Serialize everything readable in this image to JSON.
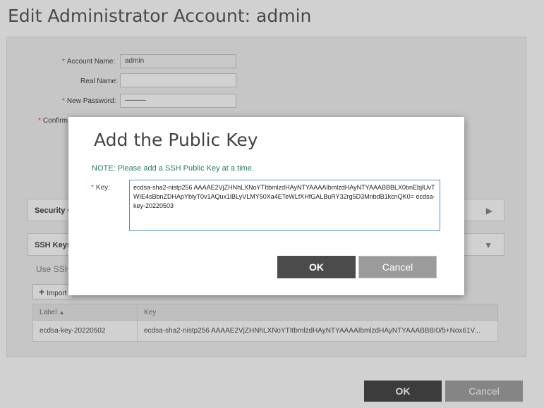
{
  "page": {
    "title": "Edit Administrator Account: admin"
  },
  "form": {
    "account_name_label": "Account Name:",
    "account_name_value": "admin",
    "real_name_label": "Real Name:",
    "real_name_value": "",
    "new_password_label": "New Password:",
    "new_password_value": "———",
    "confirm_label": "Confirm"
  },
  "sections": {
    "security_title": "Security C",
    "ssh_title": "SSH Keys"
  },
  "ssh": {
    "note": "Use SSH",
    "import_label": "Import",
    "table": {
      "col_label": "Label",
      "col_key": "Key",
      "rows": [
        {
          "label": "ecdsa-key-20220502",
          "key": "ecdsa-sha2-nistp256 AAAAE2VjZHNhLXNoYTItbmlzdHAyNTYAAAAIbmlzdHAyNTYAAABBBI0/5+Nox61V..."
        }
      ]
    }
  },
  "buttons": {
    "ok": "OK",
    "cancel": "Cancel"
  },
  "dialog": {
    "title": "Add the Public Key",
    "note": "NOTE: Please add a SSH Public Key at a time.",
    "key_label": "Key:",
    "key_value": "ecdsa-sha2-nistp256 AAAAE2VjZHNhLXNoYTItbmlzdHAyNTYAAAAIbmlzdHAyNTYAAABBBLX0bnEbjlUvTWIE4sBbnZDHApYblyT0v1AQux1lBLyVLMY50Xa4ETeWLfXHfGALBuRY32rg5D3MnbdB1kcnQK0= ecdsa-key-20220503",
    "ok": "OK",
    "cancel": "Cancel"
  },
  "colors": {
    "note_green": "#2f7a66",
    "required_red": "#d6482e",
    "ok_dark": "#4b4b4b"
  }
}
